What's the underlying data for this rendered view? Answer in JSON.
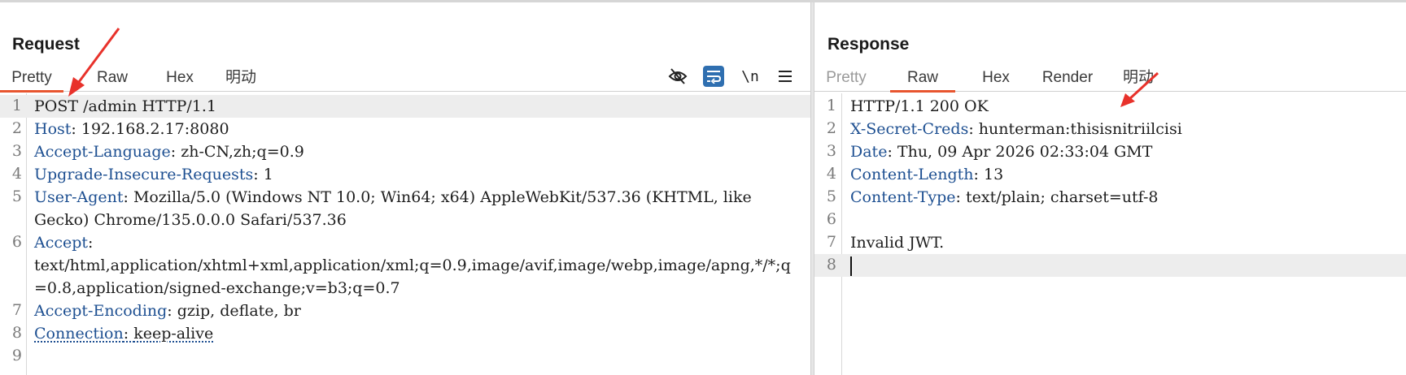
{
  "request": {
    "title": "Request",
    "tabs": [
      {
        "label": "Pretty",
        "state": "active"
      },
      {
        "label": "Raw",
        "state": "normal"
      },
      {
        "label": "Hex",
        "state": "normal"
      },
      {
        "label": "明动",
        "state": "normal"
      }
    ],
    "toolbar": {
      "hide_icon": "eye-slash-icon",
      "wrap_icon": "wrap-icon",
      "newline_label": "\\n",
      "menu_icon": "hamburger-menu-icon"
    },
    "lines": [
      {
        "num": "1",
        "key": "",
        "sep": "",
        "value": "POST /admin HTTP/1.1"
      },
      {
        "num": "2",
        "key": "Host",
        "sep": ": ",
        "value": "192.168.2.17:8080"
      },
      {
        "num": "3",
        "key": "Accept-Language",
        "sep": ": ",
        "value": "zh-CN,zh;q=0.9"
      },
      {
        "num": "4",
        "key": "Upgrade-Insecure-Requests",
        "sep": ": ",
        "value": "1"
      },
      {
        "num": "5",
        "key": "User-Agent",
        "sep": ": ",
        "value": "Mozilla/5.0 (Windows NT 10.0; Win64; x64) AppleWebKit/537.36 (KHTML, like Gecko) Chrome/135.0.0.0 Safari/537.36"
      },
      {
        "num": "6",
        "key": "Accept",
        "sep": ":",
        "value": "text/html,application/xhtml+xml,application/xml;q=0.9,image/avif,image/webp,image/apng,*/*;q=0.8,application/signed-exchange;v=b3;q=0.7"
      },
      {
        "num": "7",
        "key": "Accept-Encoding",
        "sep": ": ",
        "value": "gzip, deflate, br"
      },
      {
        "num": "8",
        "key": "Connection",
        "sep": ": ",
        "value": "keep-alive"
      },
      {
        "num": "9",
        "key": "",
        "sep": "",
        "value": ""
      }
    ]
  },
  "response": {
    "title": "Response",
    "tabs": [
      {
        "label": "Pretty",
        "state": "disabled"
      },
      {
        "label": "Raw",
        "state": "active"
      },
      {
        "label": "Hex",
        "state": "normal"
      },
      {
        "label": "Render",
        "state": "normal"
      },
      {
        "label": "明动",
        "state": "normal"
      }
    ],
    "lines": [
      {
        "num": "1",
        "key": "",
        "sep": "",
        "value": "HTTP/1.1 200 OK"
      },
      {
        "num": "2",
        "key": "X-Secret-Creds",
        "sep": ": ",
        "value": "hunterman:thisisnitriilcisi"
      },
      {
        "num": "3",
        "key": "Date",
        "sep": ": ",
        "value": "Thu, 09 Apr 2026 02:33:04 GMT"
      },
      {
        "num": "4",
        "key": "Content-Length",
        "sep": ": ",
        "value": "13"
      },
      {
        "num": "5",
        "key": "Content-Type",
        "sep": ": ",
        "value": "text/plain; charset=utf-8"
      },
      {
        "num": "6",
        "key": "",
        "sep": "",
        "value": ""
      },
      {
        "num": "7",
        "key": "",
        "sep": "",
        "value": "Invalid JWT."
      },
      {
        "num": "8",
        "key": "",
        "sep": "",
        "value": ""
      }
    ]
  },
  "colors": {
    "accent": "#e8552f",
    "header_key": "#1d4f91",
    "wrap_button": "#2f6fb0",
    "annotation_arrow": "#e8322b"
  }
}
